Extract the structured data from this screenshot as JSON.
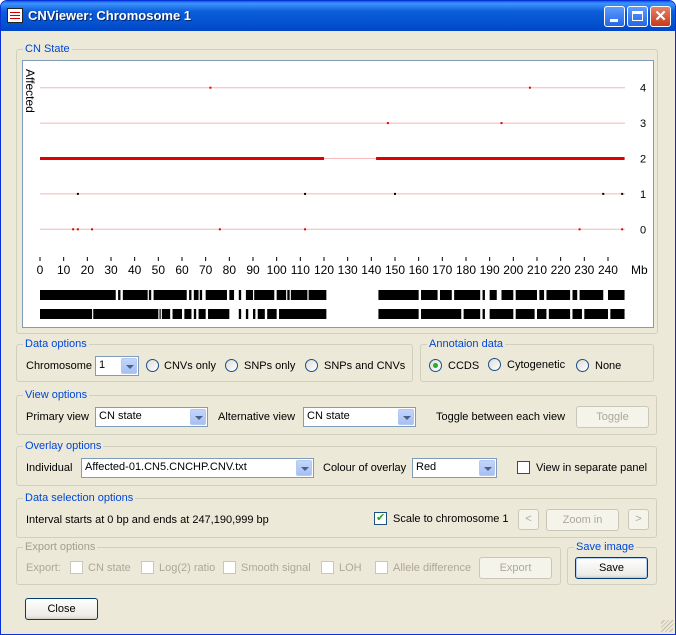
{
  "window": {
    "title": "CNViewer: Chromosome 1",
    "colors": {
      "title_bar": "#0454d1",
      "accent": "#0046d5",
      "cn_line": "#e00000"
    }
  },
  "cn_state": {
    "legend": "CN State",
    "y_label": "Affected",
    "unit_label": "Mb",
    "chart_data": {
      "type": "scatter",
      "xlim": [
        0,
        247.19
      ],
      "ylim": [
        -0.5,
        4.5
      ],
      "x_ticks": [
        0,
        10,
        20,
        30,
        40,
        50,
        60,
        70,
        80,
        90,
        100,
        110,
        120,
        130,
        140,
        150,
        160,
        170,
        180,
        190,
        200,
        210,
        220,
        230,
        240
      ],
      "y_ticks": [
        0,
        1,
        2,
        3,
        4
      ],
      "grid": true,
      "segments": [
        {
          "x_start": 0,
          "x_end": 120,
          "cn": 2
        },
        {
          "x_start": 142,
          "x_end": 247,
          "cn": 2
        }
      ],
      "points": [
        {
          "x": 72,
          "cn": 4
        },
        {
          "x": 207,
          "cn": 4
        },
        {
          "x": 147,
          "cn": 3
        },
        {
          "x": 195,
          "cn": 3
        },
        {
          "x": 16,
          "cn": 1
        },
        {
          "x": 112,
          "cn": 1
        },
        {
          "x": 150,
          "cn": 1
        },
        {
          "x": 238,
          "cn": 1
        },
        {
          "x": 246,
          "cn": 1
        },
        {
          "x": 14,
          "cn": 0
        },
        {
          "x": 16,
          "cn": 0
        },
        {
          "x": 22,
          "cn": 0
        },
        {
          "x": 76,
          "cn": 0
        },
        {
          "x": 112,
          "cn": 0
        },
        {
          "x": 228,
          "cn": 0
        },
        {
          "x": 246,
          "cn": 0
        }
      ],
      "annotation_tracks": [
        [
          [
            0,
            32
          ],
          [
            33,
            34
          ],
          [
            35,
            45.5
          ],
          [
            46,
            47
          ],
          [
            48,
            62
          ],
          [
            63,
            64
          ],
          [
            65,
            67
          ],
          [
            67.5,
            68.5
          ],
          [
            70,
            79
          ],
          [
            80,
            82
          ],
          [
            84,
            85
          ],
          [
            87,
            90
          ],
          [
            90.5,
            99
          ],
          [
            100,
            104
          ],
          [
            104.5,
            105.5
          ],
          [
            106,
            113
          ],
          [
            113.5,
            121
          ],
          [
            143,
            160
          ],
          [
            161,
            168
          ],
          [
            169,
            174
          ],
          [
            175,
            186
          ],
          [
            187,
            188
          ],
          [
            190,
            193
          ],
          [
            195,
            200
          ],
          [
            201,
            210
          ],
          [
            211,
            213
          ],
          [
            214,
            224
          ],
          [
            225,
            227
          ],
          [
            228,
            238
          ],
          [
            240,
            247
          ]
        ],
        [
          [
            0,
            22
          ],
          [
            22.5,
            50
          ],
          [
            50.5,
            51
          ],
          [
            51.5,
            55
          ],
          [
            56,
            60
          ],
          [
            61,
            64
          ],
          [
            65,
            66
          ],
          [
            67,
            70
          ],
          [
            71,
            80
          ],
          [
            84,
            85
          ],
          [
            87,
            88
          ],
          [
            90,
            91
          ],
          [
            92,
            95
          ],
          [
            96,
            100
          ],
          [
            101,
            121
          ],
          [
            143,
            160
          ],
          [
            161,
            178
          ],
          [
            179,
            186
          ],
          [
            187,
            188
          ],
          [
            190,
            200
          ],
          [
            201,
            209
          ],
          [
            210,
            214
          ],
          [
            215,
            224
          ],
          [
            225,
            229
          ],
          [
            230,
            240
          ],
          [
            241,
            247
          ]
        ]
      ]
    }
  },
  "data_options": {
    "legend": "Data options",
    "chromosome_label": "Chromosome",
    "chromosome_value": "1",
    "radio_cnvs_only": "CNVs only",
    "radio_snps_only": "SNPs only",
    "radio_snps_and_cnvs": "SNPs and CNVs"
  },
  "annotation_data": {
    "legend": "Annotaion data",
    "radio_ccds": "CCDS",
    "radio_cytogenetic": "Cytogenetic",
    "radio_none": "None"
  },
  "view_options": {
    "legend": "View options",
    "primary_label": "Primary view",
    "primary_value": "CN state",
    "alternative_label": "Alternative view",
    "alternative_value": "CN state",
    "toggle_text": "Toggle between each view",
    "toggle_button": "Toggle"
  },
  "overlay_options": {
    "legend": "Overlay options",
    "individual_label": "Individual",
    "individual_value": "Affected-01.CN5.CNCHP.CNV.txt",
    "colour_label": "Colour of overlay",
    "colour_value": "Red",
    "separate_panel_label": "View in separate panel"
  },
  "data_selection": {
    "legend": "Data selection options",
    "interval_text": "Interval starts at 0 bp and ends at 247,190,999 bp",
    "scale_label": "Scale to chromosome 1",
    "prev_arrow": "<",
    "zoom_in_button": "Zoom in",
    "next_arrow": ">"
  },
  "export_options": {
    "legend": "Export options",
    "export_label": "Export:",
    "cn_state": "CN state",
    "log2_ratio": "Log(2) ratio",
    "smooth_signal": "Smooth signal",
    "loh": "LOH",
    "allele_difference": "Allele difference",
    "export_button": "Export"
  },
  "save_image": {
    "legend": "Save image",
    "save_button": "Save"
  },
  "footer": {
    "close_button": "Close"
  }
}
